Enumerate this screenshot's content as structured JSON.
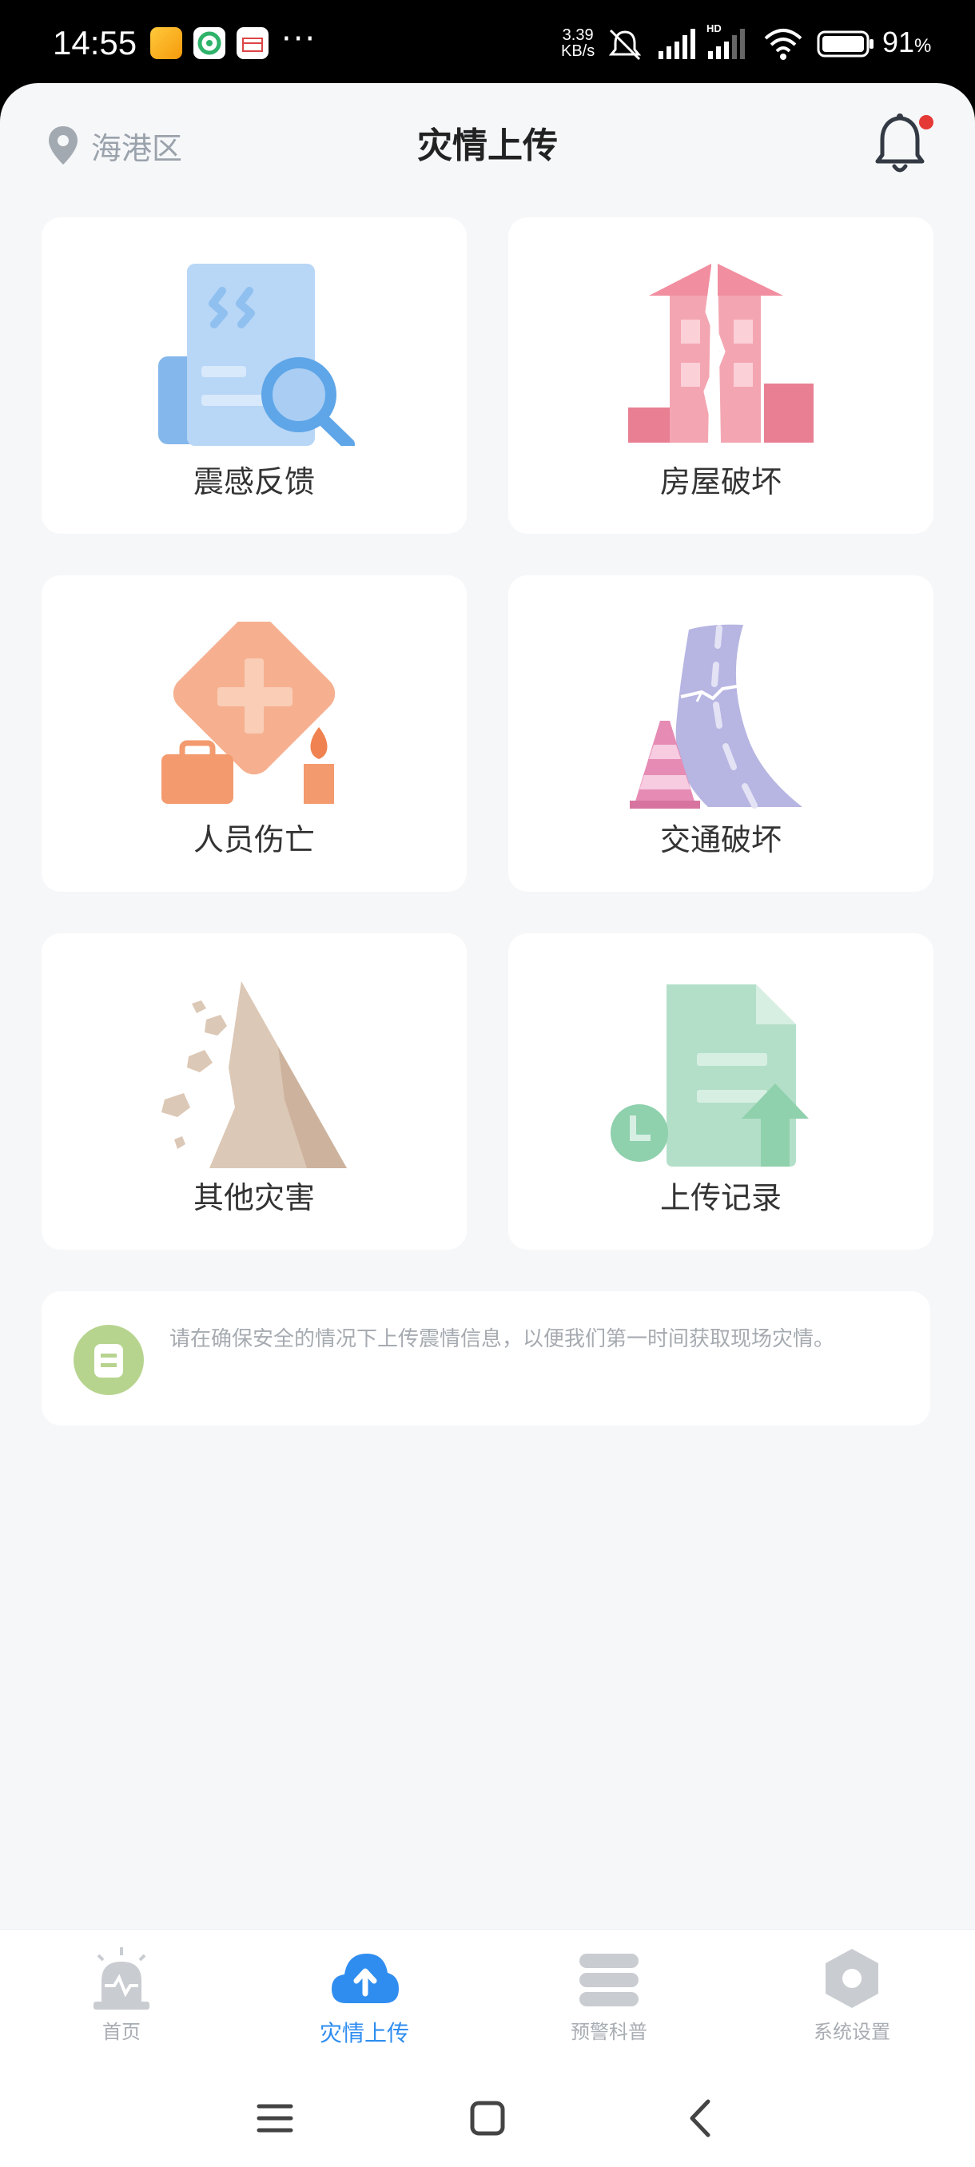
{
  "status_bar": {
    "time": "14:55",
    "net_speed_value": "3.39",
    "net_speed_unit": "KB/s",
    "battery": "91",
    "battery_unit": "%",
    "more": "···"
  },
  "header": {
    "location": "海港区",
    "title": "灾情上传"
  },
  "cards": [
    {
      "label": "震感反馈",
      "icon": "document-search-icon"
    },
    {
      "label": "房屋破坏",
      "icon": "cracked-building-icon"
    },
    {
      "label": "人员伤亡",
      "icon": "medical-casualty-icon"
    },
    {
      "label": "交通破坏",
      "icon": "cracked-road-icon"
    },
    {
      "label": "其他灾害",
      "icon": "landslide-icon"
    },
    {
      "label": "上传记录",
      "icon": "upload-record-icon"
    }
  ],
  "notice": {
    "text": "请在确保安全的情况下上传震情信息，以便我们第一时间获取现场灾情。"
  },
  "tabs": [
    {
      "label": "首页",
      "icon": "alarm-icon"
    },
    {
      "label": "灾情上传",
      "icon": "cloud-upload-icon",
      "active": true
    },
    {
      "label": "预警科普",
      "icon": "books-icon"
    },
    {
      "label": "系统设置",
      "icon": "settings-hexagon-icon"
    }
  ],
  "colors": {
    "accent": "#2f8df0",
    "notification_dot": "#e53935",
    "page_bg": "#f6f7f9"
  }
}
